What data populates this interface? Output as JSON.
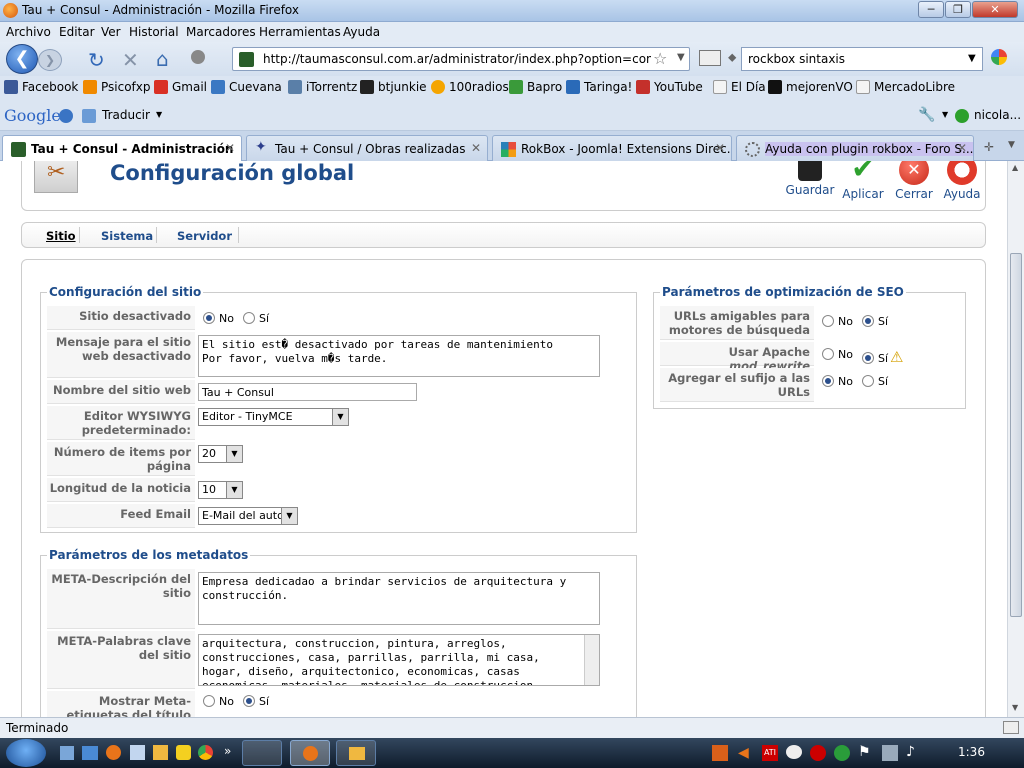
{
  "window": {
    "title": "Tau + Consul - Administración - Mozilla Firefox"
  },
  "menu": [
    "Archivo",
    "Editar",
    "Ver",
    "Historial",
    "Marcadores",
    "Herramientas",
    "Ayuda"
  ],
  "nav": {
    "url": "http://taumasconsul.com.ar/administrator/index.php?option=com_conf",
    "search": "rockbox sintaxis"
  },
  "bookmarks": [
    "Facebook",
    "Psicofxp",
    "Gmail",
    "Cuevana",
    "iTorrentz",
    "btjunkie",
    "100radios",
    "Bapro",
    "Taringa!",
    "YouTube",
    "El Día",
    "mejorenVO",
    "MercadoLibre"
  ],
  "googlebar": {
    "logo": "Google",
    "translate": "Traducir",
    "user": "nicola..."
  },
  "tabs": [
    {
      "label": "Tau + Consul - Administración",
      "active": true
    },
    {
      "label": "Tau + Consul / Obras realizadas"
    },
    {
      "label": "RokBox - Joomla! Extensions Direc..."
    },
    {
      "label": "Ayuda con plugin rokbox - Foro S..."
    }
  ],
  "page": {
    "title": "Configuración global",
    "toolbar": {
      "save": "Guardar",
      "apply": "Aplicar",
      "close": "Cerrar",
      "help": "Ayuda"
    },
    "subtabs": [
      "Sitio",
      "Sistema",
      "Servidor"
    ],
    "site": {
      "legend": "Configuración del sitio",
      "offline_label": "Sitio desactivado",
      "offline_msg_label": "Mensaje para el sitio web desactivado",
      "offline_msg": "El sitio est� desactivado por tareas de mantenimiento\nPor favor, vuelva m�s tarde.",
      "sitename_label": "Nombre del sitio web",
      "sitename": "Tau + Consul",
      "editor_label": "Editor WYSIWYG predeterminado:",
      "editor": "Editor - TinyMCE",
      "listlimit_label": "Número de items por página",
      "listlimit": "20",
      "feedlimit_label": "Longitud de la noticia",
      "feedlimit": "10",
      "feedemail_label": "Feed Email",
      "feedemail": "E-Mail del autor"
    },
    "meta": {
      "legend": "Parámetros de los metadatos",
      "desc_label": "META-Descripción del sitio",
      "desc": "Empresa dedicadao a brindar servicios de arquitectura y construcción.",
      "keys_label": "META-Palabras clave del sitio",
      "keys": "arquitectura, construccion, pintura, arreglos, construcciones, casa, parrillas, parrilla, mi casa, hogar, diseño, arquitectonico, economicas, casas economicas, materiales, materiales de construccion",
      "showtitle_label": "Mostrar Meta-etiquetas del título"
    },
    "seo": {
      "legend": "Parámetros de optimización de SEO",
      "sef_label": "URLs amigables para motores de búsqueda",
      "rewrite_label_a": "Usar Apache ",
      "rewrite_label_b": "mod_rewrite",
      "suffix_label": "Agregar el sufijo a las URLs"
    },
    "no": "No",
    "yes": "Sí"
  },
  "status": "Terminado",
  "clock": "1:36"
}
